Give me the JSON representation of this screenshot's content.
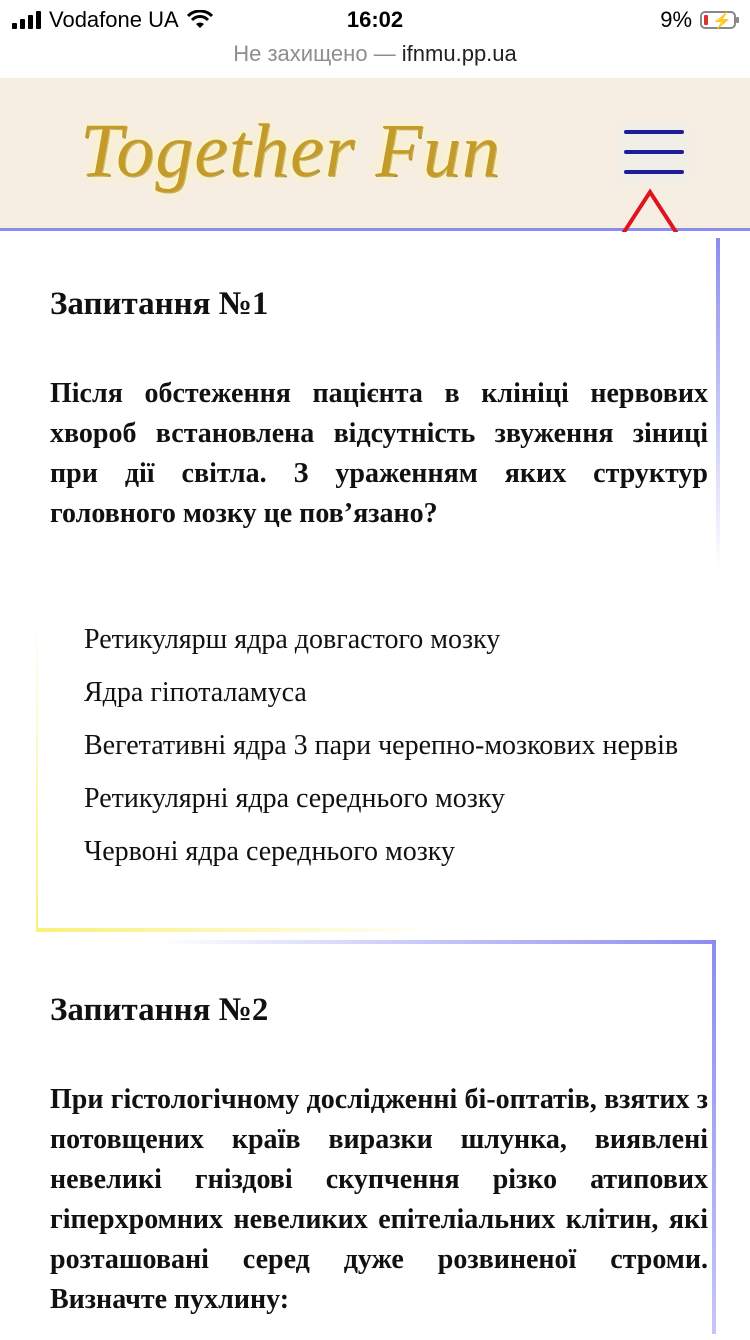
{
  "status_bar": {
    "carrier": "Vodafone UA",
    "time": "16:02",
    "battery": "9%",
    "battery_level": 0.09
  },
  "browser": {
    "security_label": "Не захищено —",
    "domain": "ifnmu.pp.ua"
  },
  "header": {
    "logo_text": "Together Fun",
    "colors": {
      "background": "#f7eee3",
      "menu_lines": "#1d1d9c",
      "accent_border": "#8b8cf0"
    }
  },
  "questions": [
    {
      "title": "Запитання №1",
      "text": "Після обстеження пацієнта в клініці нервових хвороб встановлена відсутність звуження зіниці при дії світла. З ураженням яких структур головного мозку це пов’язано?",
      "answers": [
        "Ретикулярш ядра довгастого мозку",
        "Ядра гіпоталамуса",
        "Вегетативні ядра 3 пари черепно-мозкових нервів",
        "Ретикулярні ядра середнього мозку",
        "Червоні ядра середнього мозку"
      ]
    },
    {
      "title": "Запитання №2",
      "text": "При гістологічному дослідженні бі-оптатів, взятих з потовщених країв виразки шлунка, виявлені невеликі гніздові скупчення різко атипових гіперхромних невеликих епітеліальних клітин, які розташовані серед дуже розвиненої строми. Визначте пухлину:"
    }
  ],
  "annotation": {
    "arrow_color": "#e0141e"
  }
}
